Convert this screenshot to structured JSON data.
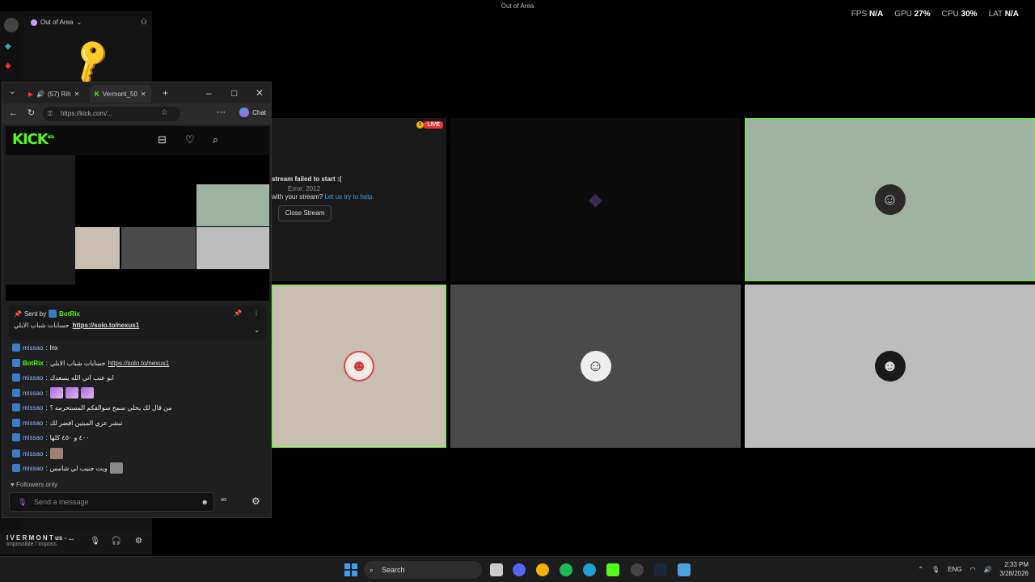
{
  "titlebar": {
    "title": "Out of Area"
  },
  "perf": {
    "fps_label": "FPS",
    "fps_value": "N/A",
    "gpu_label": "GPU",
    "gpu_value": "27%",
    "cpu_label": "CPU",
    "cpu_value": "30%",
    "lat_label": "LAT",
    "lat_value": "N/A"
  },
  "discord": {
    "server_name": "Out of Area",
    "footer_user": "I V E R M O N T us - ...",
    "footer_status": "Impossible / Imposs"
  },
  "grid": {
    "live_badge": "LIVE",
    "error_title": "stream failed to start :(",
    "error_code": "Error: 2012",
    "error_help_prefix": "with your stream?",
    "error_help_link": "Let us try to help.",
    "close_stream": "Close Stream",
    "colors": {
      "tile_green": "#9fb3a2",
      "tile_beige": "#c9bfb1",
      "tile_gray": "#4a4a4a",
      "tile_lightgray": "#bdbdbd",
      "accent_green": "#53fc18"
    }
  },
  "browser": {
    "tab1_label": "(57) Rih",
    "tab2_label": "Vermont_50",
    "url": "https://kick.com/...",
    "chat_label": "Chat",
    "kick_logo": "KICK",
    "kick_beta": "BETA"
  },
  "chat": {
    "pinned_sent_by": "Sent by",
    "pinned_user": "BotRix",
    "pinned_text": "حسابات شباب الابلي",
    "pinned_link": "https://solo.to/nexus1",
    "messages": [
      {
        "user": "missao",
        "text": "lnx"
      },
      {
        "user": "BotRix",
        "text": "حسابات شباب الابلي",
        "link": "https://solo.to/nexus1"
      },
      {
        "user": "missao",
        "text": "ابو عنب اني الله يسعدك"
      },
      {
        "user": "missao",
        "text": ""
      },
      {
        "user": "missao",
        "text": "من قال لك يحلي سمح سوالفكم المستحرمه ؟"
      },
      {
        "user": "missao",
        "text": "تبشر عزي المبتين افضر لك"
      },
      {
        "user": "missao",
        "text": "٤٠٠ و ٤٥٠ كلها"
      },
      {
        "user": "missao",
        "text": ""
      },
      {
        "user": "missao",
        "text": "وبت جبيب لي شامس"
      }
    ],
    "followers_only": "Followers only",
    "input_placeholder": "Send a message"
  },
  "taskbar": {
    "search_label": "Search",
    "lang": "ENG",
    "time": "2:33 PM",
    "date": "3/28/2026"
  }
}
